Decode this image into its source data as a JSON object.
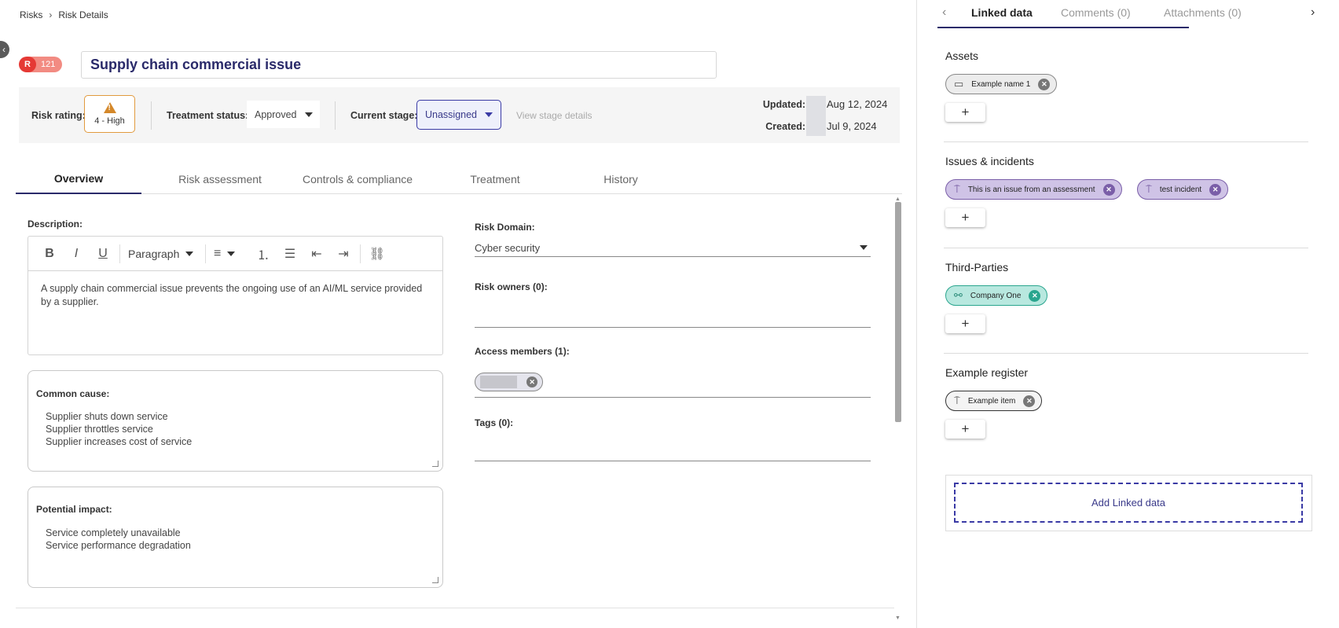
{
  "breadcrumb": {
    "root": "Risks",
    "current": "Risk Details"
  },
  "collapse_icon": "chevron-left-icon",
  "risk": {
    "prefix": "R",
    "number": "121",
    "title": "Supply chain commercial issue"
  },
  "meta": {
    "rating_label": "Risk rating:",
    "rating_value": "4 - High",
    "treatment_label": "Treatment status:",
    "treatment_value": "Approved",
    "stage_label": "Current stage:",
    "stage_value": "Unassigned",
    "stage_link": "View stage details",
    "updated_label": "Updated:",
    "updated_value": "Aug 12, 2024",
    "created_label": "Created:",
    "created_value": "Jul 9, 2024"
  },
  "tabs": [
    "Overview",
    "Risk assessment",
    "Controls & compliance",
    "Treatment",
    "History"
  ],
  "description": {
    "label": "Description:",
    "toolbar": {
      "bold": "B",
      "italic": "I",
      "underline": "U",
      "paragraph": "Paragraph",
      "align": "≡",
      "ordered": "⒈",
      "bullets": "☰",
      "outdent": "⇤",
      "indent": "⇥",
      "link": "⛓"
    },
    "text": "A supply chain commercial issue prevents the ongoing use of an AI/ML service provided by a supplier."
  },
  "common_cause": {
    "label": "Common cause:",
    "lines": [
      "Supplier shuts down service",
      "Supplier throttles service",
      "Supplier increases cost of service"
    ]
  },
  "potential_impact": {
    "label": "Potential impact:",
    "lines": [
      "Service completely unavailable",
      "Service performance degradation"
    ]
  },
  "risk_domain": {
    "label": "Risk Domain:",
    "value": "Cyber security"
  },
  "risk_owners": {
    "label": "Risk owners (0):"
  },
  "access_members": {
    "label": "Access members (1):"
  },
  "tags": {
    "label": "Tags (0):"
  },
  "right_tabs": [
    "Linked data",
    "Comments (0)",
    "Attachments (0)"
  ],
  "sections": {
    "assets": {
      "title": "Assets",
      "chips": [
        "Example name 1"
      ]
    },
    "issues": {
      "title": "Issues & incidents",
      "chips": [
        "This is an issue from an assessment",
        "test incident"
      ]
    },
    "third_parties": {
      "title": "Third-Parties",
      "chips": [
        "Company One"
      ]
    },
    "example_register": {
      "title": "Example register",
      "chips": [
        "Example item"
      ]
    }
  },
  "add_label": "+",
  "add_linked": "Add Linked data",
  "colors": {
    "accent": "#2a2a6a",
    "warning": "#d4882a",
    "risk_red": "#e53935",
    "purple": "#7a5ea8",
    "teal": "#2aa58e"
  }
}
